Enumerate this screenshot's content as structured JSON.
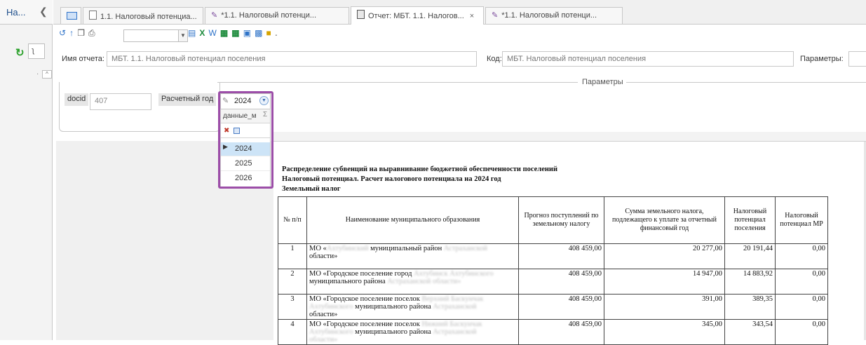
{
  "nav": {
    "title": "На...",
    "collapse_icon": "chevron-left-icon",
    "search_value": "ʅ"
  },
  "tabs": [
    {
      "label": "1.1. Налоговый потенциа...",
      "icon": "document-icon"
    },
    {
      "label": "*1.1. Налоговый потенци...",
      "icon": "pencil-icon"
    },
    {
      "label": "Отчет: МБТ. 1.1. Налогов...",
      "icon": "report-icon",
      "active": true,
      "close": "×"
    },
    {
      "label": "*1.1. Налоговый потенци...",
      "icon": "pencil-icon"
    }
  ],
  "form": {
    "report_name_label": "Имя отчета:",
    "report_name_value": "МБТ. 1.1. Налоговый потенциал поселения",
    "code_label": "Код:",
    "code_value": "МБТ. Налоговый потенциал поселения",
    "params_label": "Параметры:"
  },
  "params": {
    "group_title": "Параметры",
    "docid_label": "docid",
    "docid_value": "407",
    "year_label": "Расчетный год",
    "year_value": "2024"
  },
  "dropdown": {
    "column_header": "данные_м",
    "sigma": "Σ",
    "options": [
      "2024",
      "2025",
      "2026"
    ],
    "selected": "2024"
  },
  "report": {
    "title_line1": "Распределение субвенций на выравнивание бюджетной обеспеченности поселений",
    "title_line2": "Налоговый потенциал. Расчет налогового потенциала на 2024 год",
    "title_line3": "Земельный налог",
    "columns": [
      "№ п/п",
      "Наименование муниципального образования",
      "Прогноз поступлений по земельному налогу",
      "Сумма земельного налога, подлежащего к уплате за отчетный финансовый год",
      "Налоговый потенциал поселения",
      "Налоговый потенциал МР"
    ],
    "rows": [
      {
        "n": "1",
        "name_a": "МО «",
        "name_b": "Ахтубинский",
        "name_c": " муниципальный район",
        "name_d": " Астраханской",
        "name_e": "области»",
        "forecast": "408 459,00",
        "tax": "20 277,00",
        "pot": "20 191,44",
        "mr": "0,00"
      },
      {
        "n": "2",
        "name_a": "МО «Городское поселение город ",
        "name_b": "Ахтубинск Ахтубинского",
        "name_c": "муниципального района ",
        "name_d": "Астраханской области»",
        "name_e": "",
        "forecast": "408 459,00",
        "tax": "14 947,00",
        "pot": "14 883,92",
        "mr": "0,00"
      },
      {
        "n": "3",
        "name_a": "МО «Городское поселение поселок ",
        "name_b": "Верхний Баскунчак",
        "name_c": "Ахтубинского",
        "name_d": " муниципального района ",
        "name_e": "Астраханской",
        "name_f": "области»",
        "forecast": "408 459,00",
        "tax": "391,00",
        "pot": "389,35",
        "mr": "0,00"
      },
      {
        "n": "4",
        "name_a": "МО «Городское поселение поселок ",
        "name_b": "Нижний Баскунчак",
        "name_c": "Ахтубинского",
        "name_d": " муниципального района ",
        "name_e": "Астраханской",
        "name_f": "области»",
        "forecast": "408 459,00",
        "tax": "345,00",
        "pot": "343,54",
        "mr": "0,00"
      }
    ]
  },
  "colors": {
    "highlight": "#9c4ea8",
    "selected_row": "#cde4f7",
    "accent": "#2f73c8"
  }
}
